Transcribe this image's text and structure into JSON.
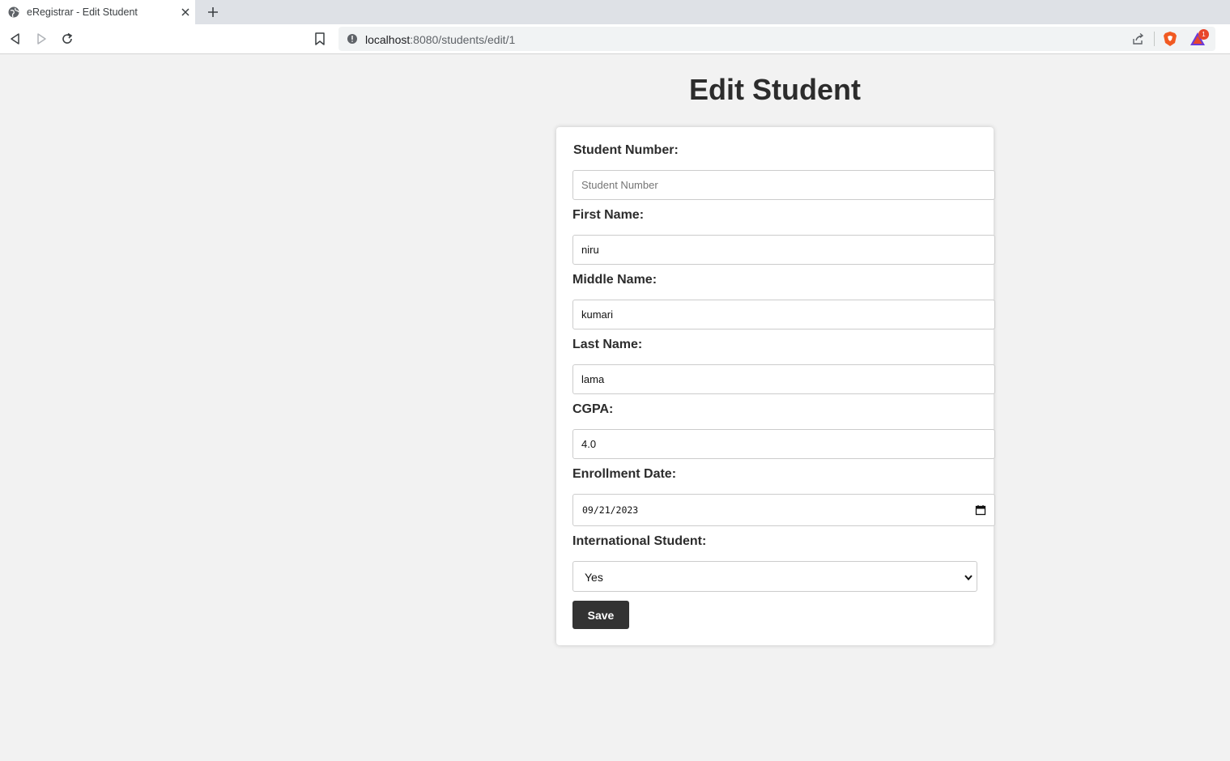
{
  "browser": {
    "tab_title": "eRegistrar - Edit Student",
    "url_host": "localhost",
    "url_rest": ":8080/students/edit/1",
    "rewards_badge": "1"
  },
  "page": {
    "title": "Edit Student"
  },
  "form": {
    "student_number": {
      "label": "Student Number:",
      "value": "",
      "placeholder": "Student Number"
    },
    "first_name": {
      "label": "First Name:",
      "value": "niru"
    },
    "middle_name": {
      "label": "Middle Name:",
      "value": "kumari"
    },
    "last_name": {
      "label": "Last Name:",
      "value": "lama"
    },
    "cgpa": {
      "label": "CGPA:",
      "value": "4.0"
    },
    "enrollment_date": {
      "label": "Enrollment Date:",
      "value": "09/21/2023"
    },
    "international": {
      "label": "International Student:",
      "value": "Yes"
    },
    "save_label": "Save"
  },
  "colors": {
    "page_bg": "#f2f2f2",
    "button_bg": "#333333",
    "text": "#2c2c2c"
  }
}
